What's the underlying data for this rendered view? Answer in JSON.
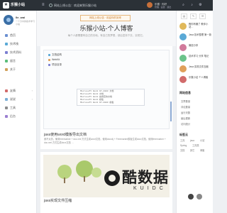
{
  "header": {
    "logo_glyph": "★",
    "site_name": "乐猴小站",
    "menu_icon": "menu-icon",
    "notice": "网站上线公告：欢迎来到乐猴小站",
    "user_name": "乐猴 · 你好",
    "user_sub": "管理 · 设置 · 退出"
  },
  "left": {
    "profile_name": "lle_wai",
    "profile_desc": "一个分享的技术学习小站",
    "nav": [
      {
        "label": "首页",
        "color": "#6b8fd1"
      },
      {
        "label": "技术栈",
        "color": "#5aa9d6"
      },
      {
        "label": "技术资料",
        "color": "#7b7fd1"
      },
      {
        "label": "留言",
        "color": "#5bbd7a"
      },
      {
        "label": "关于",
        "color": "#d1a05a"
      },
      {
        "label": "友情",
        "color": "#d16b6b"
      },
      {
        "label": "说说",
        "color": "#7aaed6"
      },
      {
        "label": "工具",
        "color": "#8c8c8c"
      },
      {
        "label": "后台",
        "color": "#9b7fd1"
      }
    ]
  },
  "hero": {
    "badge": "网站上线公告  · 欢迎你的到来",
    "title": "乐猴小站-个人博客",
    "subtitle": "每个人都需要有自己的天地，有自己的梦想，然后坚持下去，实现它。"
  },
  "article1": {
    "doc_rows": [
      "文档结构",
      "WebKit",
      "项目目录"
    ],
    "doc_lines": [
      "Microsoft Word 97-2003 文档",
      "Microsoft Word 文档",
      "Microsoft Word 启用宏的文档",
      "Microsoft Word 模板",
      "Microsoft Word 97-2003 模板"
    ],
    "title": "java使用word模板导出文档",
    "excerpt": "我不太熟，使用freemarker + doc.xml 方式生成word文档，使用docx4j + Freemarker模板生成docx文档，使用freemarker + doc.xml 方式生成docx文档 …"
  },
  "article2": {
    "watermark": "酷数据",
    "watermark_sub": "KUIDC",
    "title": "java实现文件压缩"
  },
  "right": {
    "tabs": [
      "▤",
      "✎",
      "☰"
    ],
    "posts": [
      {
        "text": "教你有赚了 教你小站…",
        "color": "#e0b85a"
      },
      {
        "text": "Java 技术整理 第一篇",
        "color": "#5aa9d6"
      },
      {
        "text": "微信分享",
        "color": "#d17a9b"
      },
      {
        "text": "技术学习 分享 笔记",
        "color": "#6bc38a"
      },
      {
        "text": "Java 实现文件压缩",
        "color": "#e0a05a"
      },
      {
        "text": "乐猴小站 个人博客",
        "color": "#d16b6b"
      }
    ],
    "section1": "网站信息",
    "info_rows": [
      "文章数量",
      "评论数量",
      "运行天数",
      "最后更新",
      "访问统计"
    ],
    "section2": "标签云",
    "tags": [
      "工具",
      "java",
      "小站",
      "Spring",
      "工具类",
      "文档",
      "其它",
      "博客"
    ]
  }
}
